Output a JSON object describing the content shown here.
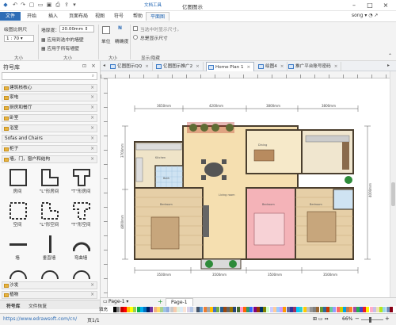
{
  "window": {
    "title": "亿图图示",
    "context_group": "文档工具"
  },
  "ribbon_tabs": [
    "文件",
    "开始",
    "插入",
    "页面布局",
    "视图",
    "符号",
    "帮助",
    "平面图"
  ],
  "user": "song",
  "ribbon": {
    "scale_label": "绘图比例尺",
    "scale_value": "1 : 70",
    "wall_thickness_label": "墙厚度：",
    "wall_thickness_value": "20.00mm",
    "apply_selected": "应用到选中的墙壁",
    "apply_all": "应用于所有墙壁",
    "unit_label": "单位",
    "precision_label": "精确度",
    "show_current_dim": "当选中时显示尺寸。",
    "always_show_dim": "总是显示尺寸",
    "group_size_1": "大小",
    "group_size_2": "大小",
    "group_size_3": "大小",
    "group_display": "显示/隐藏"
  },
  "doc_tabs": [
    {
      "label": "亿图图示QQ"
    },
    {
      "label": "亿图图示推广2"
    },
    {
      "label": "Home Plan 1",
      "active": true
    },
    {
      "label": "绘图4"
    },
    {
      "label": "推广平台账号密码"
    }
  ],
  "left_panel": {
    "title": "符号库",
    "search_placeholder": "",
    "libraries": [
      "建筑核核心",
      "家电",
      "厨房和餐厅",
      "卧室",
      "浴室",
      "Sofas and Chairs",
      "柜子",
      "墙，门，窗户和结构"
    ],
    "shapes": [
      "房间",
      "\"L\"形房间",
      "\"T\"形房间",
      "空间",
      "\"L\"形空间",
      "\"T\"形空间",
      "墙",
      "垂直墙",
      "弯曲墙"
    ],
    "bottom_libraries": [
      "沙发",
      "植物"
    ],
    "bottom_tabs": [
      "符号库",
      "文件恢复"
    ]
  },
  "plan": {
    "dims_top": [
      "3650mm",
      "4200mm",
      "3800mm",
      "3800mm"
    ],
    "dims_bottom": [
      "3500mm",
      "3500mm",
      "3500mm",
      "3500mm"
    ],
    "dims_left": [
      "3700mm",
      "4800mm"
    ],
    "dims_right": [
      "4000mm"
    ],
    "room_labels": [
      "Kitchen",
      "Living room",
      "Bedroom",
      "Bedroom",
      "Bedroom",
      "Bath",
      "Dining"
    ]
  },
  "page_bar": {
    "page_select": "Page-1",
    "add": "+",
    "current_page": "Page-1"
  },
  "status": {
    "url": "https://www.edrawsoft.com/cn/",
    "page_info": "页1/1",
    "zoom": "66%",
    "fill_label": "填充"
  },
  "colors": {
    "accent": "#2e6db6",
    "plan_tab": "#1f64b3"
  }
}
